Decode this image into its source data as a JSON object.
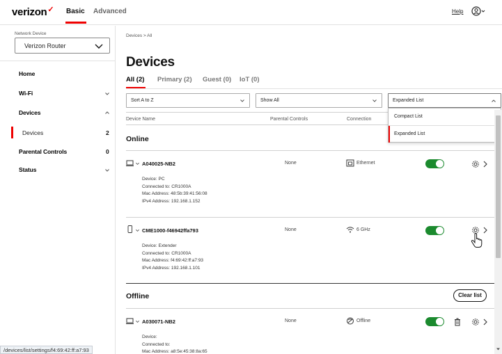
{
  "header": {
    "logo": "verizon",
    "tabs": [
      {
        "label": "Basic",
        "active": true
      },
      {
        "label": "Advanced",
        "active": false
      }
    ],
    "help": "Help",
    "account_icon": "account-icon"
  },
  "sidebar": {
    "network_device_label": "Network Device",
    "network_device_value": "Verizon Router",
    "items": [
      {
        "label": "Home"
      },
      {
        "label": "Wi-Fi"
      },
      {
        "label": "Devices"
      },
      {
        "label": "Parental Controls",
        "count": "0"
      },
      {
        "label": "Status"
      }
    ],
    "sub_item": {
      "label": "Devices",
      "count": "2"
    }
  },
  "main": {
    "breadcrumb": "Devices > All",
    "title": "Devices",
    "filter_tabs": [
      "All (2)",
      "Primary (2)",
      "Guest (0)",
      "IoT (0)"
    ],
    "sort_select": "Sort A to Z",
    "show_select": "Show All",
    "view_select": "Expanded List",
    "view_options": [
      "Compact List",
      "Expanded List"
    ],
    "columns": [
      "Device Name",
      "Parental Controls",
      "Connection"
    ],
    "online_title": "Online",
    "offline_title": "Offline",
    "clear_list": "Clear list",
    "devices": [
      {
        "name": "A040025-NB2",
        "parental": "None",
        "connection": "Ethernet",
        "details": [
          "Device: PC",
          "Connected to: CR1000A",
          "Mac Address: 48:5b:39:41:56:08",
          "IPv4 Address: 192.168.1.152"
        ]
      },
      {
        "name": "CME1000-f46942ffa793",
        "parental": "None",
        "connection": "6 GHz",
        "details": [
          "Device: Extender",
          "Connected to: CR1000A",
          "Mac Address: f4:69:42:ff:a7:93",
          "IPv4 Address: 192.168.1.101"
        ]
      },
      {
        "name": "A030071-NB2",
        "parental": "None",
        "connection": "Offline",
        "details": [
          "Device:",
          "Connected to:",
          "Mac Address: a8:5e:45:38:8a:65"
        ]
      }
    ]
  },
  "status_url": "/devices/list/settings/f4:69:42:ff:a7:93",
  "colors": {
    "accent": "#e00000",
    "toggle_on": "#1b8a2e"
  }
}
